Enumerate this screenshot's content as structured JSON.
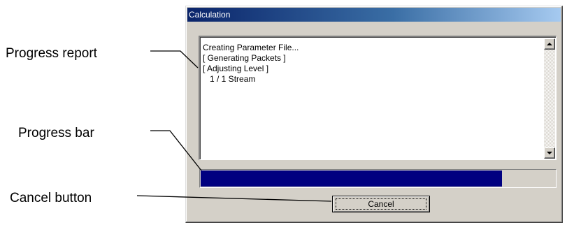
{
  "callouts": {
    "progress_report": "Progress report",
    "progress_bar": "Progress bar",
    "cancel_button": "Cancel button"
  },
  "dialog": {
    "title": "Calculation",
    "report_lines": [
      "Creating Parameter File...",
      "[ Generating Packets ]",
      "[ Adjusting Level ]",
      "   1 / 1 Stream"
    ],
    "progress_fraction": 0.85,
    "cancel_label": "Cancel"
  },
  "colors": {
    "title_bar": "#0a246a",
    "progress_fill": "#000080",
    "dialog_face": "#d4d0c8"
  }
}
